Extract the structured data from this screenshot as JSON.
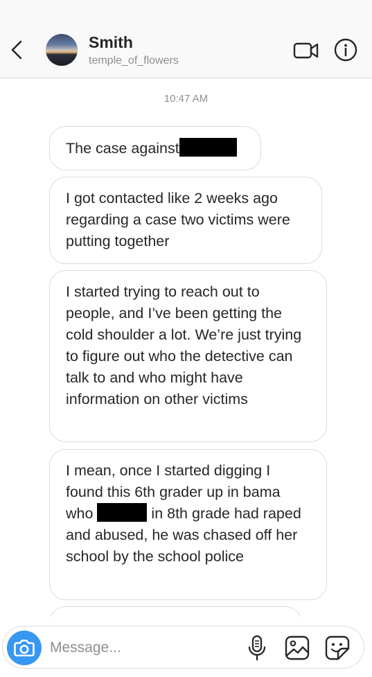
{
  "header": {
    "contact_name": "Smith",
    "username": "temple_of_flowers",
    "icons": [
      "back-icon",
      "video-camera-icon",
      "info-icon"
    ]
  },
  "thread": {
    "timestamp": "10:47 AM",
    "messages": [
      {
        "text": "The case against",
        "redacted": true
      },
      {
        "text": "I got contacted like 2 weeks ago regarding a case two victims were putting together"
      },
      {
        "text": "I started trying to reach out to people, and I’ve been getting the cold shoulder a lot. We’re just trying to figure out who the detective can talk to and who might have information on other victims"
      },
      {
        "text_before": "I mean, once I started digging I found this 6th grader up in bama who",
        "text_after": "in 8th grade had raped and abused, he was chased off her school by the school police",
        "redacted": true
      }
    ]
  },
  "composer": {
    "placeholder": "Message...",
    "icons": [
      "camera-icon",
      "microphone-icon",
      "gallery-icon",
      "sticker-icon"
    ]
  },
  "colors": {
    "accent": "#3897f0",
    "bubble_border": "#dbdbdb",
    "muted_text": "#8e8e8e",
    "header_bg": "#f9f9f9"
  }
}
